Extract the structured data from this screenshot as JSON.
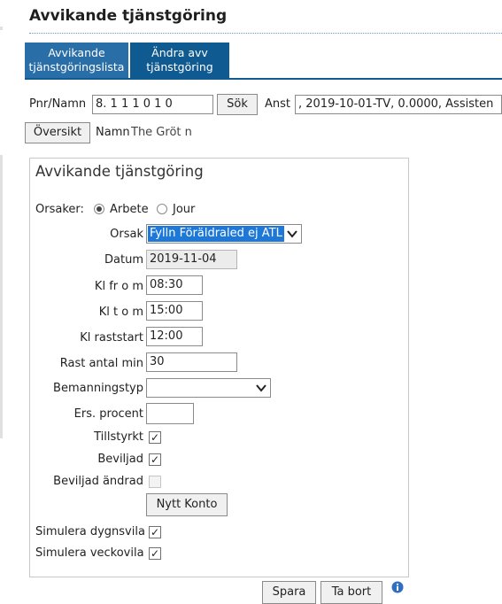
{
  "page": {
    "title": "Avvikande tjänstgöring"
  },
  "tabs": [
    {
      "line1": "Avvikande",
      "line2": "tjänstgöringslista"
    },
    {
      "line1": "Ändra avv",
      "line2": "tjänstgöring"
    }
  ],
  "search": {
    "pnr_label": "Pnr/Namn",
    "pnr_value": "8. 1 1 1 0 1 0",
    "search_button": "Sök",
    "anst_label": "Anst",
    "anst_value": "   , 2019-10-01-TV, 0.0000, Assisten",
    "overview_button": "Översikt",
    "namn_label": "Namn",
    "namn_value": "The       Gröt      n"
  },
  "form": {
    "title": "Avvikande tjänstgöring",
    "orsaker_label": "Orsaker:",
    "radio_arbete": "Arbete",
    "radio_jour": "Jour",
    "orsak_label": "Orsak",
    "orsak_value": "Fylln Föräldraled ej ATL",
    "datum_label": "Datum",
    "datum_value": "2019-11-04",
    "klfrom_label": "Kl fr o m",
    "klfrom_value": "08:30",
    "kltom_label": "Kl t o m",
    "kltom_value": "15:00",
    "rast_start_label": "Kl raststart",
    "rast_start_value": "12:00",
    "rast_min_label": "Rast antal min",
    "rast_min_value": "30",
    "bemanning_label": "Bemanningstyp",
    "bemanning_value": "",
    "ers_label": "Ers. procent",
    "ers_value": "",
    "tillstyrkt_label": "Tillstyrkt",
    "beviljad_label": "Beviljad",
    "beviljad_andrad_label": "Beviljad ändrad",
    "nytt_konto_button": "Nytt Konto",
    "dygnsvila_label": "Simulera dygnsvila",
    "veckovila_label": "Simulera veckovila",
    "checks": {
      "tillstyrkt": "✓",
      "beviljad": "✓",
      "dygnsvila": "✓",
      "veckovila": "✓"
    }
  },
  "footer": {
    "spara_button": "Spara",
    "tabort_button": "Ta bort"
  },
  "icons": {
    "select_chevron": "chevron-down-icon",
    "info": "info-icon"
  },
  "colors": {
    "tab_bg": "#0f5a91",
    "tab_active_bg": "#2a6ea8",
    "select_highlight": "#1e78d7"
  }
}
